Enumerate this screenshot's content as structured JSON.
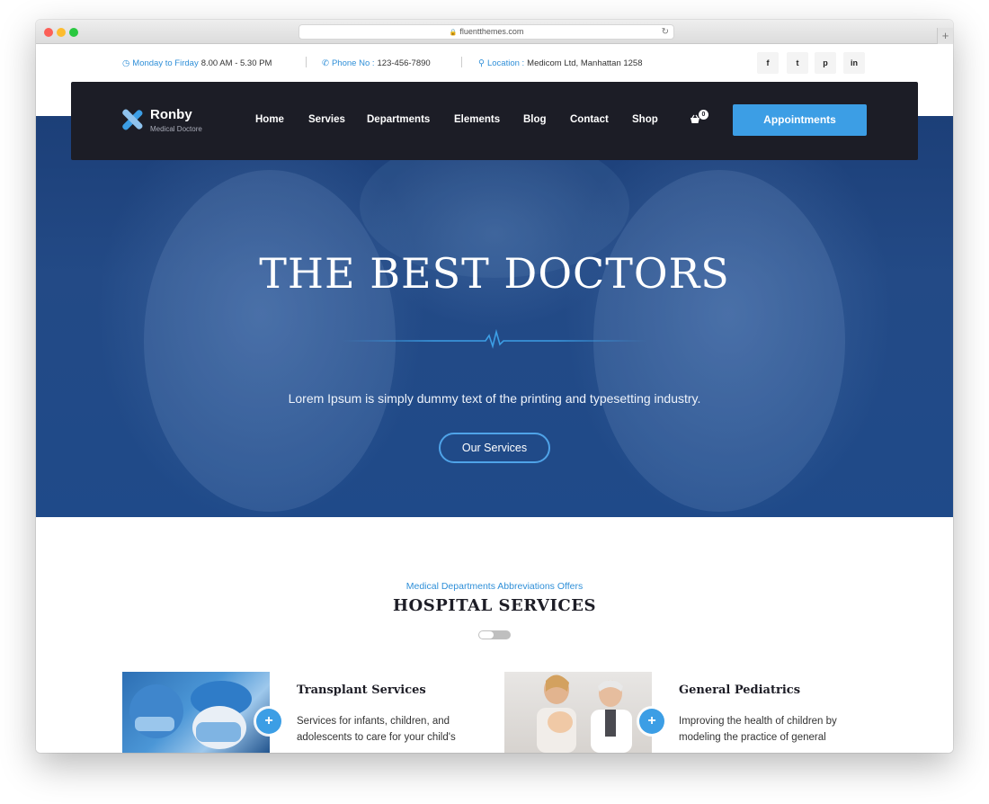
{
  "browser": {
    "url": "fluentthemes.com"
  },
  "topbar": {
    "hours_label": "Monday to Firday",
    "hours_value": "8.00 AM - 5.30 PM",
    "phone_label": "Phone No :",
    "phone_value": "123-456-7890",
    "location_label": "Location :",
    "location_value": "Medicom Ltd, Manhattan 1258",
    "social": [
      {
        "icon": "facebook-icon",
        "glyph": "f"
      },
      {
        "icon": "twitter-icon",
        "glyph": "t"
      },
      {
        "icon": "pinterest-icon",
        "glyph": "p"
      },
      {
        "icon": "linkedin-icon",
        "glyph": "in"
      }
    ]
  },
  "nav": {
    "logo_name": "Ronby",
    "logo_tag": "Medical Doctore",
    "items": [
      "Home",
      "Servies",
      "Departments",
      "Elements",
      "Blog",
      "Contact",
      "Shop"
    ],
    "cart_count": "0",
    "cta_label": "Appointments"
  },
  "hero": {
    "title": "THE BEST DOCTORS",
    "subtitle": "Lorem Ipsum is simply dummy text of the printing and typesetting industry.",
    "button_label": "Our Services"
  },
  "services": {
    "eyebrow": "Medical Departments Abbreviations Offers",
    "title": "HOSPITAL SERVICES",
    "cards": [
      {
        "title": "Transplant Services",
        "text": "Services for infants, children, and adolescents to care for your child's"
      },
      {
        "title": "General Pediatrics",
        "text": "Improving the health of children by modeling the practice of general"
      }
    ]
  },
  "colors": {
    "accent": "#3c9ee5",
    "nav_bg": "#1c1d26",
    "hero_bg": "#234a86"
  }
}
